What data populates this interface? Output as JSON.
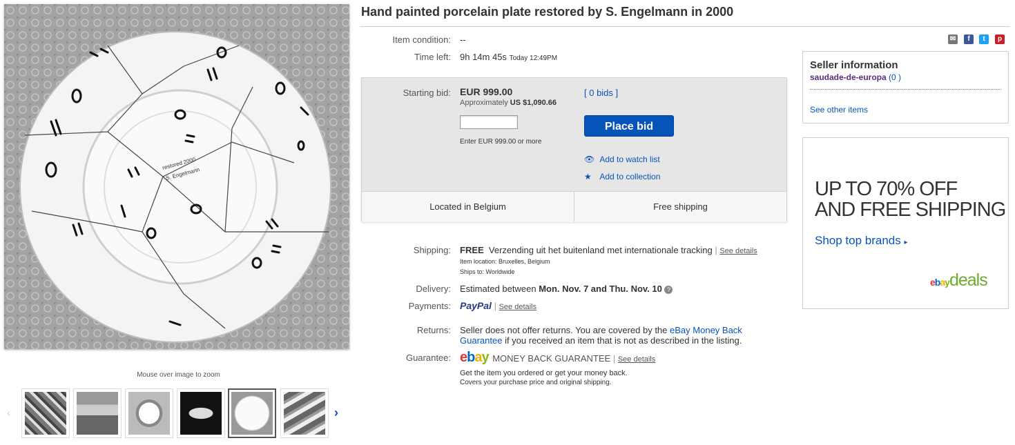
{
  "listing": {
    "title": "Hand painted porcelain plate restored by S. Engelmann in 2000",
    "zoom_hint": "Mouse over image to zoom",
    "item_condition_label": "Item condition:",
    "item_condition_value": "--",
    "time_left_label": "Time left:",
    "time_left_value": "9h 14m 45s",
    "time_left_end": "Today 12:49PM"
  },
  "bid": {
    "starting_bid_label": "Starting bid:",
    "starting_bid_value": "EUR 999.00",
    "approx_prefix": "Approximately",
    "approx_value": "US $1,090.66",
    "bids_link": "[ 0 bids ]",
    "input_value": "",
    "enter_hint": "Enter EUR 999.00 or more",
    "place_bid_label": "Place bid",
    "watch_label": "Add to watch list",
    "collection_label": "Add to collection",
    "location": "Located in Belgium",
    "shipping_free": "Free shipping"
  },
  "details": {
    "shipping_label": "Shipping:",
    "shipping_free": "FREE",
    "shipping_desc": "Verzending uit het buitenland met internationale tracking",
    "see_details": "See details",
    "item_location": "Item location:  Bruxelles, Belgium",
    "ships_to": "Ships to:  Worldwide",
    "delivery_label": "Delivery:",
    "delivery_prefix": "Estimated between",
    "delivery_dates": "Mon. Nov. 7 and Thu. Nov. 10",
    "payments_label": "Payments:",
    "paypal": "PayPal",
    "returns_label": "Returns:",
    "returns_text": "Seller does not offer returns. You are covered by the",
    "returns_link": "eBay Money Back Guarantee",
    "returns_text2": "if you received an item that is not as described in the listing.",
    "guarantee_label": "Guarantee:",
    "guarantee_title": "MONEY BACK GUARANTEE",
    "guarantee_line1": "Get the item you ordered or get your money back.",
    "guarantee_line2": "Covers your purchase price and original shipping."
  },
  "seller": {
    "heading": "Seller information",
    "name": "saudade-de-europa",
    "feedback": "(0 )",
    "see_other": "See other items"
  },
  "ad": {
    "line1_a": "UP TO ",
    "line1_b": "70% OFF",
    "line2": "AND FREE SHIPPING",
    "cta": "Shop top brands",
    "brand_ebay": "ebay",
    "brand_deals": "deals"
  },
  "thumbnails": [
    "broken plate pieces",
    "man holding plate",
    "plate on table",
    "glass plate",
    "plate back marked",
    "broken fragments"
  ],
  "colors": {
    "accent": "#0654ba",
    "seller_name": "#5a2d82",
    "deals_green": "#6bac2f"
  }
}
